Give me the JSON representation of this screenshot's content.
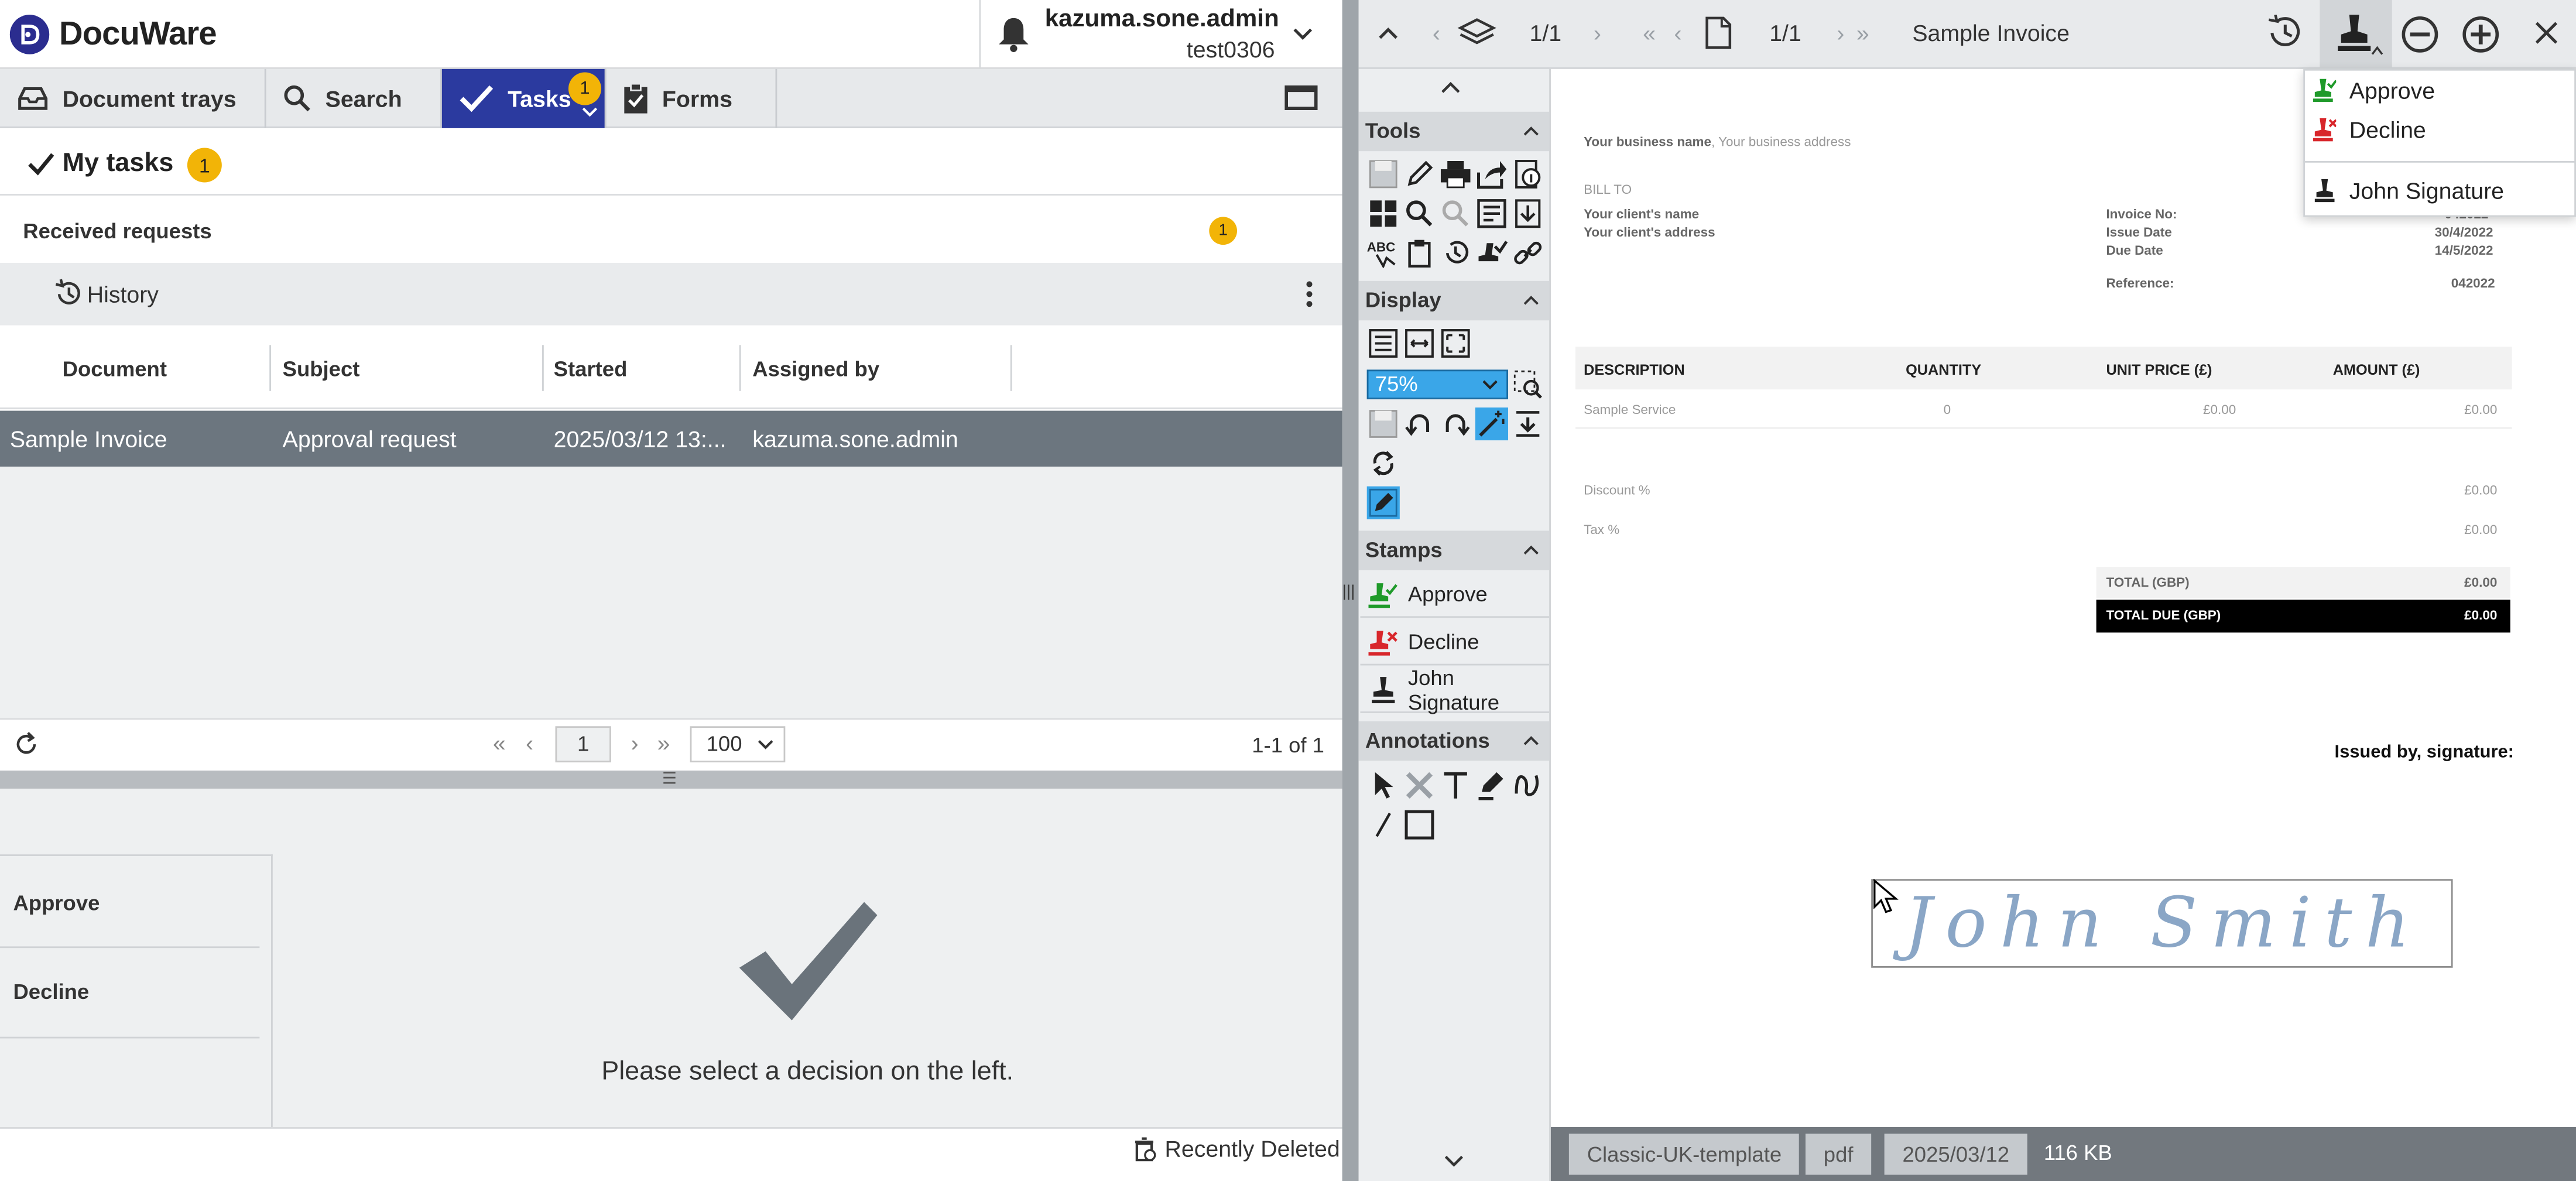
{
  "app": {
    "name": "DocuWare",
    "user_name": "kazuma.sone.admin",
    "tenant": "test0306"
  },
  "nav": {
    "tabs": [
      {
        "label": "Document trays",
        "icon": "tray-icon"
      },
      {
        "label": "Search",
        "icon": "search-icon"
      },
      {
        "label": "Tasks",
        "icon": "check-icon",
        "badge": "1",
        "active": true
      },
      {
        "label": "Forms",
        "icon": "clipboard-icon"
      }
    ]
  },
  "tasks": {
    "title": "My tasks",
    "badge": "1",
    "section_title": "Received requests",
    "section_badge": "1",
    "history_label": "History",
    "columns": [
      "Document",
      "Subject",
      "Started",
      "Assigned by"
    ],
    "rows": [
      [
        "Sample Invoice",
        "Approval request",
        "2025/03/12 13:...",
        "kazuma.sone.admin"
      ]
    ],
    "pager": {
      "page": "1",
      "page_size": "100",
      "count": "1-1 of 1"
    }
  },
  "decision": {
    "options": [
      "Approve",
      "Decline"
    ],
    "message": "Please select a decision on the left."
  },
  "footer": {
    "recently_deleted": "Recently Deleted"
  },
  "viewer": {
    "layers_page": "1/1",
    "page": "1/1",
    "doc_title": "Sample Invoice",
    "zoom": "75%",
    "panel": {
      "tools": "Tools",
      "display": "Display",
      "stamps": "Stamps",
      "annotations": "Annotations"
    },
    "stamps": [
      {
        "label": "Approve",
        "color": "#1f9a2a"
      },
      {
        "label": "Decline",
        "color": "#d8262b"
      },
      {
        "label": "John Signature",
        "color": "#222222"
      }
    ],
    "stamp_menu": [
      "Approve",
      "Decline",
      "John Signature"
    ],
    "doc_footer": {
      "template": "Classic-UK-template",
      "type": "pdf",
      "date": "2025/03/12",
      "size": "116 KB"
    }
  },
  "invoice": {
    "business": "Your business name",
    "address": "Your business address",
    "bill_to": "BILL TO",
    "client_name": "Your client's name",
    "client_address": "Your client's address",
    "invoice_no_label": "Invoice No:",
    "invoice_no": "042022",
    "issue_label": "Issue Date",
    "issue_date": "30/4/2022",
    "due_label": "Due Date",
    "due_date": "14/5/2022",
    "reference_label": "Reference:",
    "reference": "042022",
    "headers": [
      "DESCRIPTION",
      "QUANTITY",
      "UNIT PRICE (£)",
      "AMOUNT (£)"
    ],
    "line": {
      "desc": "Sample Service",
      "qty": "0",
      "unit": "£0.00",
      "amount": "£0.00"
    },
    "discount_label": "Discount %",
    "discount": "£0.00",
    "tax_label": "Tax %",
    "tax": "£0.00",
    "total_label": "TOTAL (GBP)",
    "total": "£0.00",
    "total_due_label": "TOTAL DUE (GBP)",
    "total_due": "£0.00",
    "issued_by": "Issued by, signature:",
    "signature": "John Smith"
  },
  "colors": {
    "accent": "#2b3a9f",
    "badge": "#f2b407",
    "selected_row": "#6c767f",
    "zoom_box": "#3aa6e8"
  }
}
